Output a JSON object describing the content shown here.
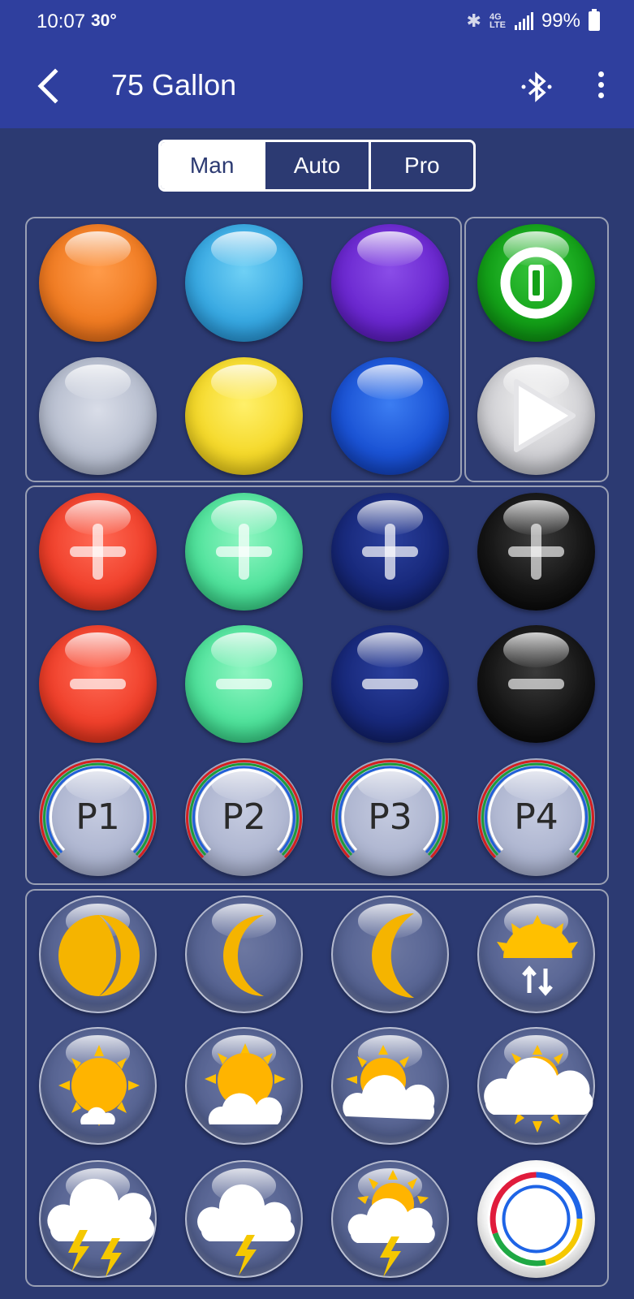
{
  "status_bar": {
    "time": "10:07",
    "temperature": "30°",
    "network": "4G LTE",
    "battery": "99%"
  },
  "app_bar": {
    "title": "75 Gallon",
    "icons": [
      "back-arrow-icon",
      "bluetooth-icon",
      "more-vert-icon"
    ]
  },
  "mode_tabs": {
    "selected": "Man",
    "items": [
      {
        "label": "Man"
      },
      {
        "label": "Auto"
      },
      {
        "label": "Pro"
      }
    ]
  },
  "color_buttons": [
    "orange",
    "cyan",
    "purple",
    "white",
    "yellow",
    "blue"
  ],
  "control_buttons": [
    "power-icon",
    "play-icon"
  ],
  "brightness": {
    "plus": [
      "red",
      "green",
      "blue",
      "white"
    ],
    "minus": [
      "red",
      "green",
      "blue",
      "white"
    ]
  },
  "presets": [
    {
      "label": "P1"
    },
    {
      "label": "P2"
    },
    {
      "label": "P3"
    },
    {
      "label": "P4"
    }
  ],
  "scenes": [
    "moon-full-icon",
    "moon-half-icon",
    "moon-crescent-icon",
    "sunrise-sunset-icon",
    "sunny-icon",
    "mostly-sunny-icon",
    "partly-cloudy-icon",
    "cloudy-icon",
    "thunderstorm-icon",
    "storm-icon",
    "sun-storm-icon",
    "color-cycle-icon"
  ],
  "colors": {
    "status_bar": "#2f3f9e",
    "background": "#2c3a72",
    "panel_border": "#9aa0b4",
    "moon": "#f5b400"
  }
}
